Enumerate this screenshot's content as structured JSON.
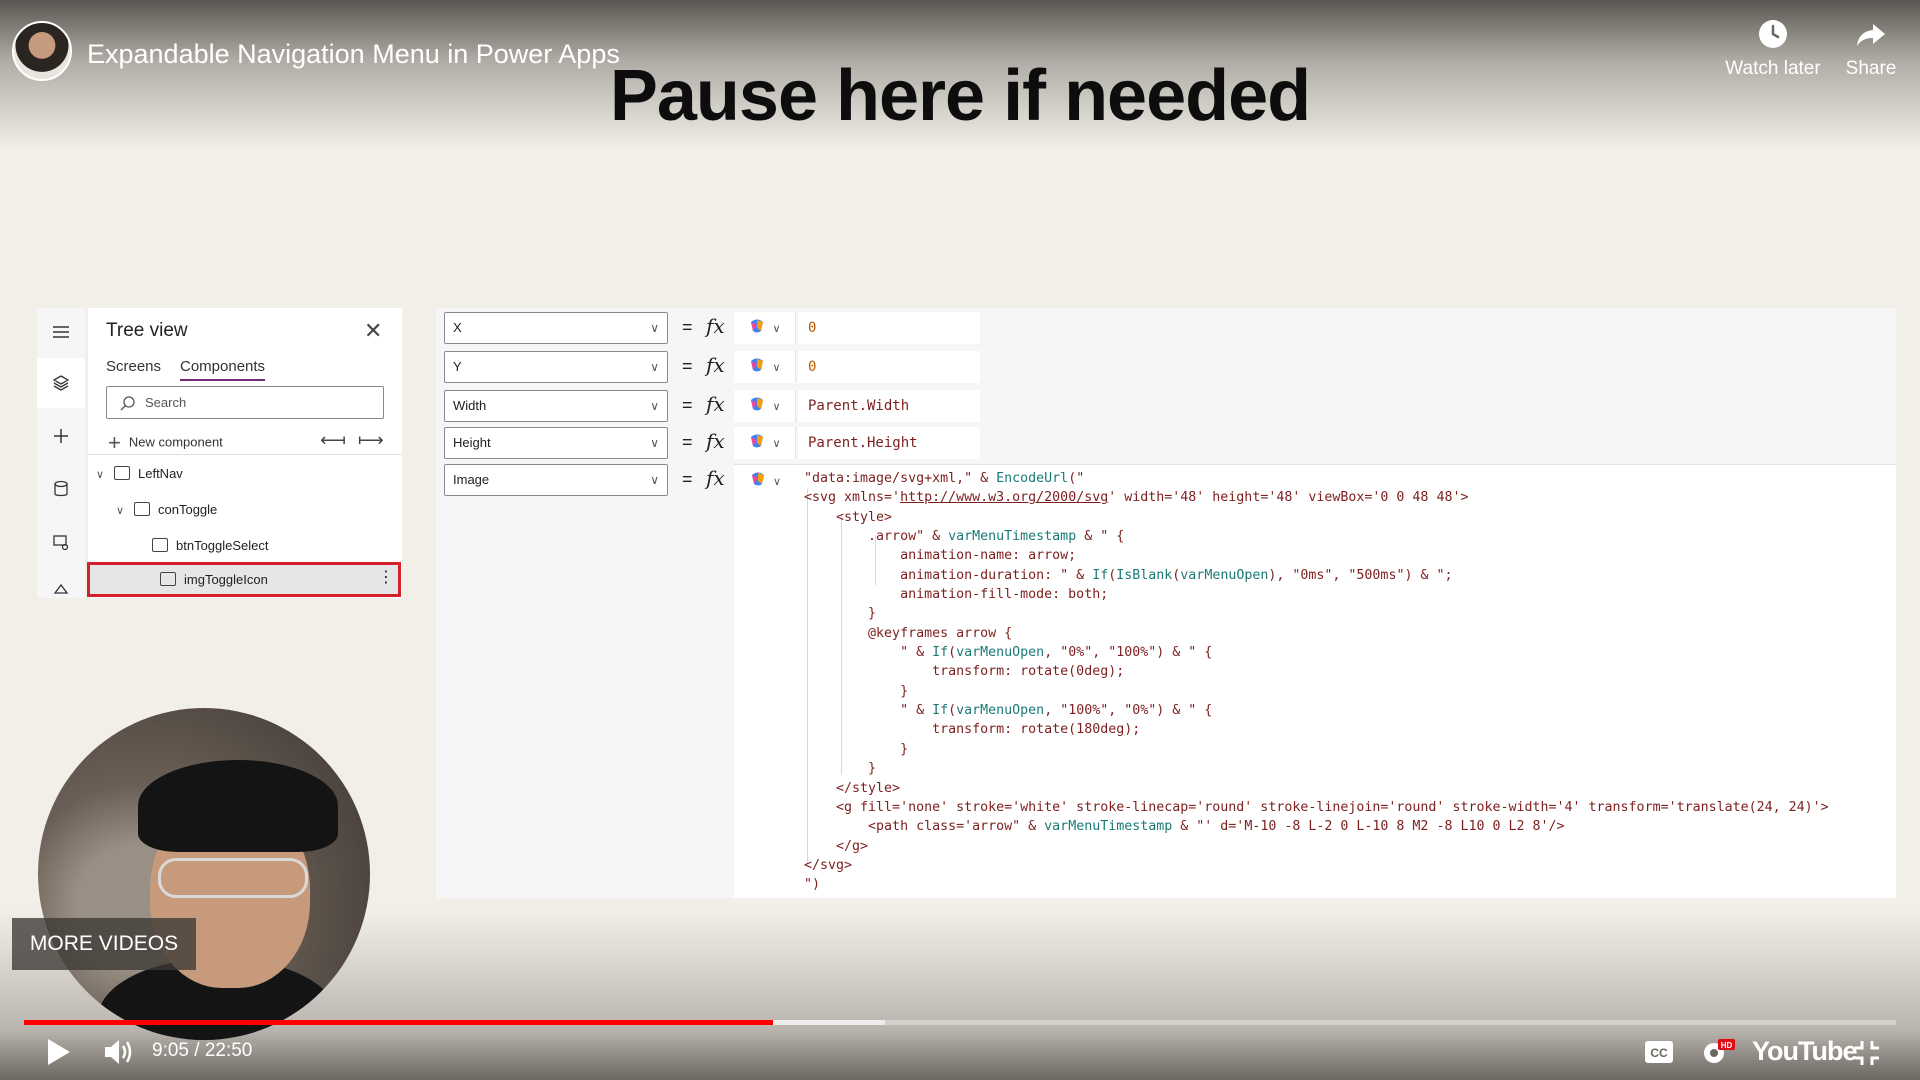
{
  "video": {
    "title": "Expandable Navigation Menu in Power Apps",
    "watch_later_label": "Watch later",
    "share_label": "Share",
    "overlay_heading": "Pause here if needed",
    "more_videos_label": "MORE VIDEOS",
    "time_display": "9:05 / 22:50",
    "progress_fraction": 0.4,
    "buffered_fraction": 0.46,
    "brand": "YouTube",
    "hd_badge": "HD",
    "colors": {
      "progress": "#ff0000"
    }
  },
  "power_apps": {
    "tree_view": {
      "title": "Tree view",
      "tabs": [
        "Screens",
        "Components"
      ],
      "active_tab": "Components",
      "search_placeholder": "Search",
      "new_component_label": "New component",
      "nodes": [
        {
          "label": "LeftNav",
          "icon": "component-icon"
        },
        {
          "label": "conToggle",
          "icon": "container-icon"
        },
        {
          "label": "btnToggleSelect",
          "icon": "button-icon"
        },
        {
          "label": "imgToggleIcon",
          "icon": "image-icon",
          "selected": true
        }
      ]
    },
    "properties": [
      {
        "name": "X",
        "value": "0"
      },
      {
        "name": "Y",
        "value": "0"
      },
      {
        "name": "Width",
        "value": "Parent.Width"
      },
      {
        "name": "Height",
        "value": "Parent.Height"
      },
      {
        "name": "Image",
        "value": ""
      }
    ],
    "formula_lines": [
      "\"data:image/svg+xml,\" & EncodeUrl(\"",
      "<svg xmlns='http://www.w3.org/2000/svg' width='48' height='48' viewBox='0 0 48 48'>",
      "    <style>",
      "        .arrow\" & varMenuTimestamp & \" {",
      "            animation-name: arrow;",
      "            animation-duration: \" & If(IsBlank(varMenuOpen), \"0ms\", \"500ms\") & \";",
      "            animation-fill-mode: both;",
      "        }",
      "        @keyframes arrow {",
      "            \" & If(varMenuOpen, \"0%\", \"100%\") & \" {",
      "                transform: rotate(0deg);",
      "            }",
      "            \" & If(varMenuOpen, \"100%\", \"0%\") & \" {",
      "                transform: rotate(180deg);",
      "            }",
      "        }",
      "    </style>",
      "    <g fill='none' stroke='white' stroke-linecap='round' stroke-linejoin='round' stroke-width='4' transform='translate(24, 24)'>",
      "        <path class='arrow\" & varMenuTimestamp & \"' d='M-10 -8 L-2 0 L-10 8 M2 -8 L10 0 L2 8'/>",
      "    </g>",
      "</svg>",
      "\")"
    ]
  }
}
